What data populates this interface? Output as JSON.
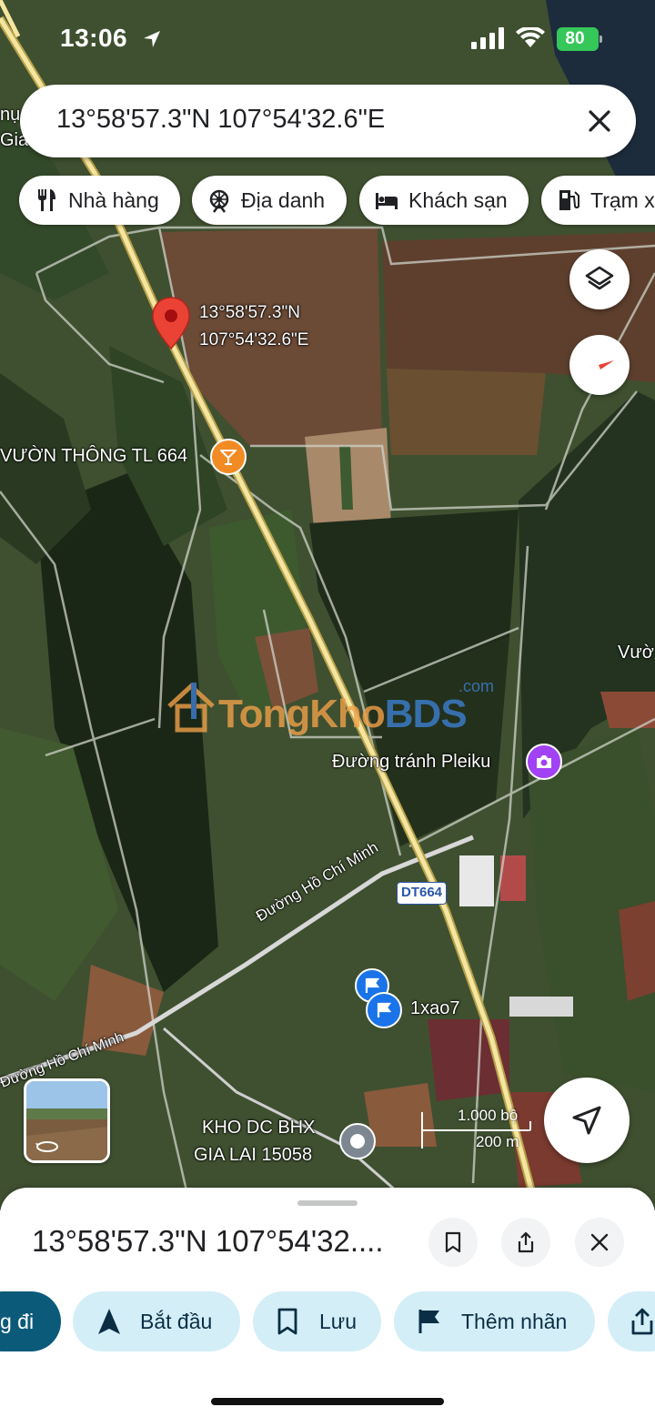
{
  "status_bar": {
    "time": "13:06",
    "battery": "80"
  },
  "search": {
    "query": "13°58'57.3\"N 107°54'32.6\"E"
  },
  "chips": [
    {
      "label": "Nhà hàng",
      "icon": "restaurant-icon"
    },
    {
      "label": "Địa danh",
      "icon": "landmark-icon"
    },
    {
      "label": "Khách sạn",
      "icon": "hotel-icon"
    },
    {
      "label": "Trạm x",
      "icon": "gas-station-icon"
    }
  ],
  "map": {
    "pin": {
      "line1": "13°58'57.3\"N",
      "line2": "107°54'32.6\"E"
    },
    "labels": {
      "vuon_thong": "VƯỜN THÔNG TL 664",
      "duong_tranh": "Đường tránh Pleiku",
      "vuon_edge": "Vườ",
      "ho_chi_minh_1": "Đường Hồ Chí Minh",
      "ho_chi_minh_2": "Đường Hồ Chí Minh",
      "route": "DT664",
      "parking": "1xao7",
      "kho_line1": "KHO DC BHX",
      "kho_line2": "GIA LAI 15058",
      "edge_1": "nụ",
      "edge_2": "Gia"
    },
    "watermark": {
      "part1": "Tong",
      "part2": "Kho",
      "part3": "BDS",
      "suffix": ".com"
    },
    "scale": {
      "imperial": "1.000 bộ",
      "metric": "200 m"
    }
  },
  "sheet": {
    "title": "13°58'57.3\"N 107°54'32....",
    "actions": [
      {
        "label": "g đi",
        "icon": "directions-icon"
      },
      {
        "label": "Bắt đầu",
        "icon": "navigation-icon"
      },
      {
        "label": "Lưu",
        "icon": "bookmark-icon"
      },
      {
        "label": "Thêm nhãn",
        "icon": "flag-icon"
      },
      {
        "label": "",
        "icon": "share-icon"
      }
    ]
  },
  "colors": {
    "pin": "#ea4335",
    "poi_orange": "#f28b24",
    "poi_purple": "#a142f4",
    "parking_blue": "#1a73e8",
    "action_primary": "#0b5a7a",
    "action_bg": "#d3eef7"
  }
}
